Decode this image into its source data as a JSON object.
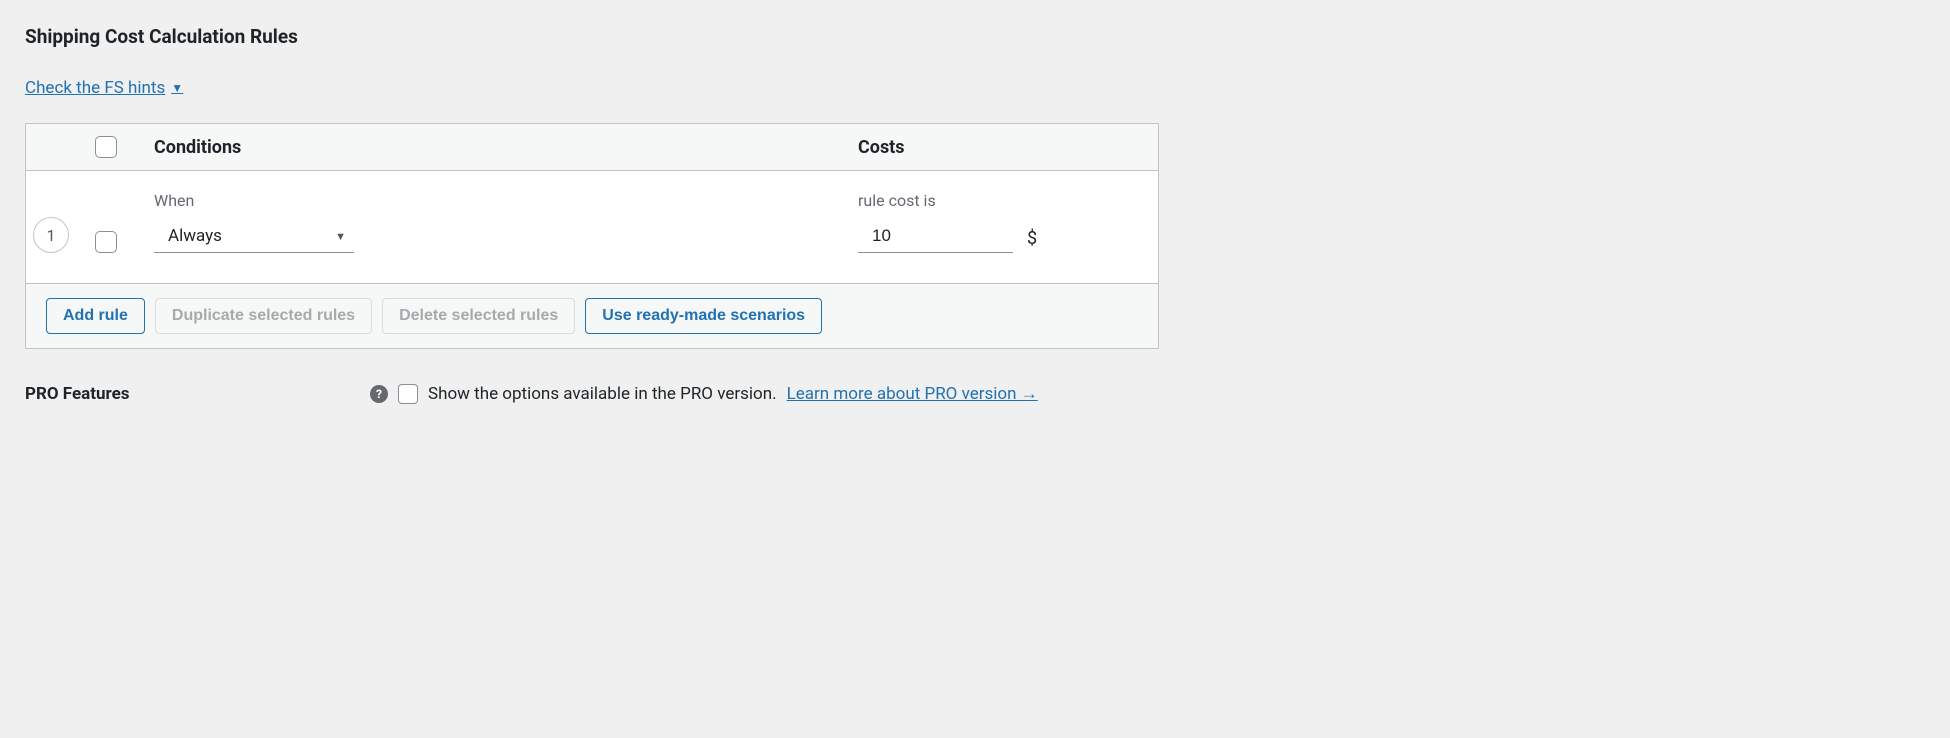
{
  "section": {
    "title": "Shipping Cost Calculation Rules",
    "hints_link": "Check the FS hints"
  },
  "table": {
    "headers": {
      "conditions": "Conditions",
      "costs": "Costs"
    },
    "rows": [
      {
        "number": "1",
        "when_label": "When",
        "condition_value": "Always",
        "cost_label": "rule cost is",
        "cost_value": "10",
        "currency": "$"
      }
    ],
    "footer": {
      "add_rule": "Add rule",
      "duplicate": "Duplicate selected rules",
      "delete": "Delete selected rules",
      "scenarios": "Use ready-made scenarios"
    }
  },
  "pro": {
    "label": "PRO Features",
    "help": "?",
    "text": "Show the options available in the PRO version.",
    "link": "Learn more about PRO version →"
  }
}
